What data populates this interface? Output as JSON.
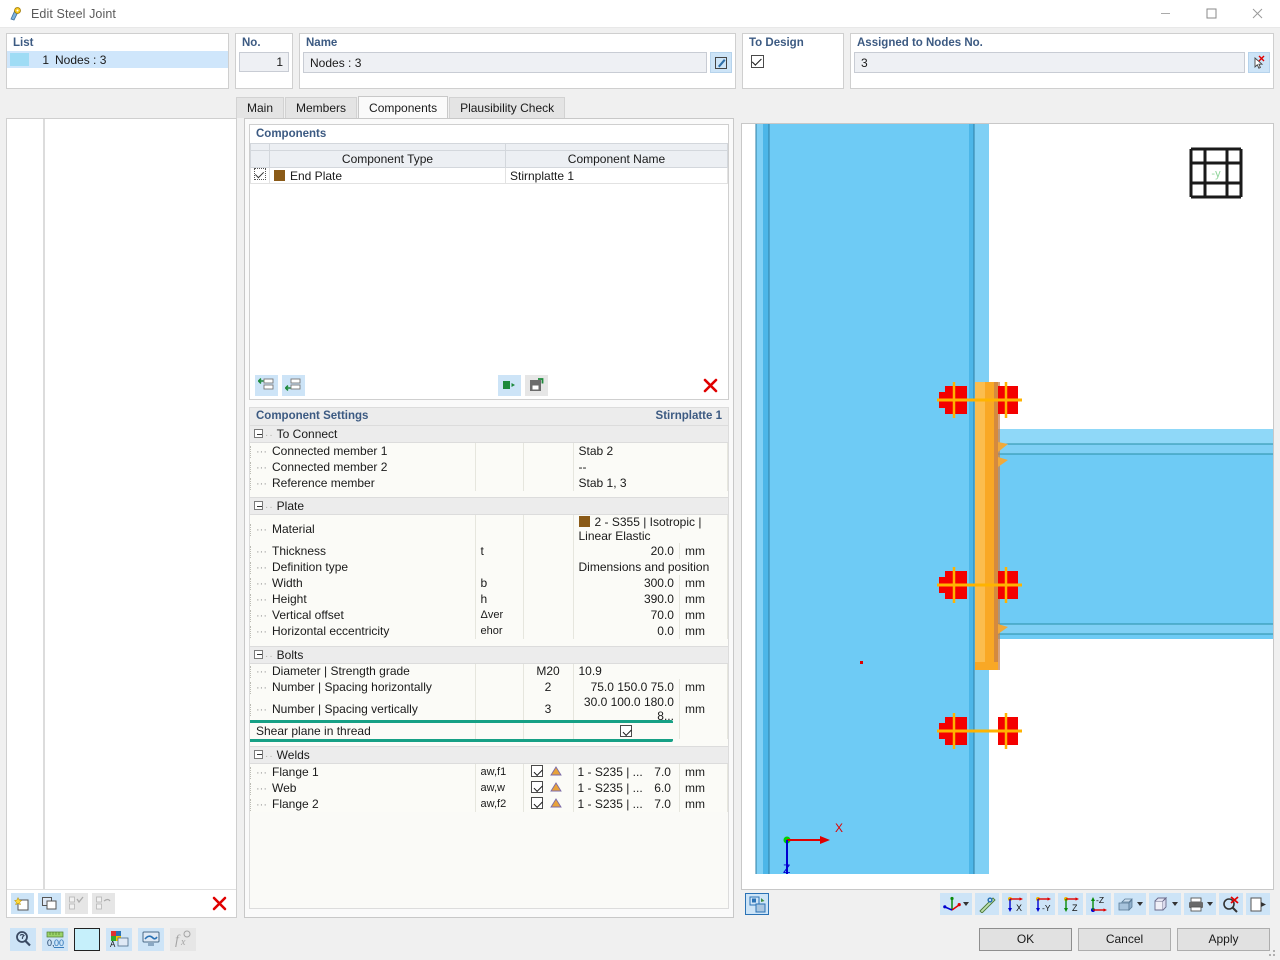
{
  "window": {
    "title": "Edit Steel Joint",
    "icon": "steel-joint-icon",
    "minimize": "—",
    "maximize": "□",
    "close": "✕"
  },
  "list_panel": {
    "label": "List",
    "rows": [
      {
        "number": "1",
        "text": "Nodes : 3"
      }
    ]
  },
  "header": {
    "no_label": "No.",
    "no_value": "1",
    "name_label": "Name",
    "name_value": "Nodes : 3",
    "name_edit_icon": "edit-pencil-icon",
    "to_design_label": "To Design",
    "to_design_checked": true,
    "assigned_label": "Assigned to Nodes No.",
    "assigned_value": "3",
    "assigned_pick_icon": "pick-node-cursor-icon"
  },
  "tabs": [
    {
      "label": "Main",
      "active": false
    },
    {
      "label": "Members",
      "active": false
    },
    {
      "label": "Components",
      "active": true
    },
    {
      "label": "Plausibility Check",
      "active": false
    }
  ],
  "components_box": {
    "title": "Components",
    "columns": [
      "Component Type",
      "Component Name"
    ],
    "rows": [
      {
        "checked": true,
        "color": "#8a5a17",
        "type": "End Plate",
        "name": "Stirnplatte 1"
      }
    ],
    "toolbar": [
      {
        "icon": "insert-row-above-icon",
        "name": "insert-component-button"
      },
      {
        "icon": "insert-row-below-icon",
        "name": "append-component-button"
      },
      {
        "icon": "import-component-icon",
        "name": "import-component-button"
      },
      {
        "icon": "save-component-icon",
        "name": "save-component-button"
      },
      {
        "icon": "delete-red-x-icon",
        "name": "delete-component-button"
      }
    ]
  },
  "component_settings": {
    "title": "Component Settings",
    "subtitle": "Stirnplatte 1",
    "groups": [
      {
        "name": "To Connect",
        "expanded": true,
        "rows": [
          {
            "label": "Connected member 1",
            "symbol": "",
            "value": "Stab 2",
            "unit": ""
          },
          {
            "label": "Connected member 2",
            "symbol": "",
            "value": "--",
            "unit": ""
          },
          {
            "label": "Reference member",
            "symbol": "",
            "value": "Stab 1, 3",
            "unit": ""
          }
        ]
      },
      {
        "name": "Plate",
        "expanded": true,
        "rows": [
          {
            "label": "Material",
            "symbol": "",
            "value": "2 - S355 | Isotropic | Linear Elastic",
            "unit": "",
            "swatch": "#8a5a17"
          },
          {
            "label": "Thickness",
            "symbol": "t",
            "value": "20.0",
            "unit": "mm",
            "numeric": true
          },
          {
            "label": "Definition type",
            "symbol": "",
            "value": "Dimensions and position",
            "unit": ""
          },
          {
            "label": "Width",
            "symbol": "b",
            "value": "300.0",
            "unit": "mm",
            "numeric": true
          },
          {
            "label": "Height",
            "symbol": "h",
            "value": "390.0",
            "unit": "mm",
            "numeric": true
          },
          {
            "label": "Vertical offset",
            "symbol": "Δver",
            "value": "70.0",
            "unit": "mm",
            "numeric": true
          },
          {
            "label": "Horizontal eccentricity",
            "symbol": "ehor",
            "value": "0.0",
            "unit": "mm",
            "numeric": true
          }
        ]
      },
      {
        "name": "Bolts",
        "expanded": true,
        "rows": [
          {
            "label": "Diameter | Strength grade",
            "symbol": "",
            "mid": "M20",
            "value": "10.9",
            "unit": ""
          },
          {
            "label": "Number | Spacing horizontally",
            "symbol": "",
            "mid": "2",
            "value": "75.0 150.0 75.0",
            "unit": "mm",
            "numeric": true
          },
          {
            "label": "Number | Spacing vertically",
            "symbol": "",
            "mid": "3",
            "value": "30.0 100.0 180.0 8...",
            "unit": "mm",
            "numeric": true
          },
          {
            "label": "Shear plane in thread",
            "symbol": "",
            "mid": "",
            "value": "",
            "unit": "",
            "checkbox": true,
            "checked": true,
            "highlighted": true
          }
        ]
      },
      {
        "name": "Welds",
        "expanded": true,
        "rows": [
          {
            "label": "Flange 1",
            "symbol": "aw,f1",
            "checked": true,
            "weld_icon": "weld-symbol-icon",
            "material": "1 - S235 | ...",
            "value": "7.0",
            "unit": "mm"
          },
          {
            "label": "Web",
            "symbol": "aw,w",
            "checked": true,
            "weld_icon": "weld-symbol-icon",
            "material": "1 - S235 | ...",
            "value": "6.0",
            "unit": "mm"
          },
          {
            "label": "Flange 2",
            "symbol": "aw,f2",
            "checked": true,
            "weld_icon": "weld-symbol-icon",
            "material": "1 - S235 | ...",
            "value": "7.0",
            "unit": "mm"
          }
        ]
      }
    ],
    "highlight_color": "#16a085"
  },
  "left_toolbar": [
    {
      "icon": "new-item-icon",
      "name": "new-joint-button",
      "enabled": true
    },
    {
      "icon": "copy-item-icon",
      "name": "copy-joint-button",
      "enabled": true
    },
    {
      "icon": "select-all-icon",
      "name": "select-all-button",
      "enabled": false
    },
    {
      "icon": "invert-selection-icon",
      "name": "invert-selection-button",
      "enabled": false
    },
    {
      "icon": "delete-red-x-icon",
      "name": "delete-joint-button",
      "enabled": true
    }
  ],
  "viewport": {
    "axis_x_label": "X",
    "axis_z_label": "Z",
    "nav_cube_label": "-y",
    "colors": {
      "member": "#6ecbf5",
      "plate": "#f9a825",
      "bolt": "#f40000",
      "background": "#ffffff",
      "axis_x": "#e00000",
      "axis_z": "#0000d0",
      "origin": "#00d000"
    },
    "toolbar": [
      {
        "icon": "render-mode-icon",
        "name": "toggle-render-mode-button",
        "framed": true
      },
      {
        "icon": "coordinate-system-icon",
        "name": "coordinate-system-button",
        "caret": true
      },
      {
        "icon": "measure-icon",
        "name": "measure-button"
      },
      {
        "icon": "view-x-icon",
        "name": "view-in-x-button"
      },
      {
        "icon": "view-minus-y-icon",
        "name": "view-against-y-button"
      },
      {
        "icon": "view-z-icon",
        "name": "view-in-z-button"
      },
      {
        "icon": "view-minus-z-icon",
        "name": "view-against-z-button"
      },
      {
        "icon": "shading-icon",
        "name": "display-mode-button",
        "caret": true
      },
      {
        "icon": "wireframe-cube-icon",
        "name": "view-style-button",
        "caret": true
      },
      {
        "icon": "print-icon",
        "name": "print-button",
        "caret": true
      },
      {
        "icon": "zoom-reset-icon",
        "name": "reset-zoom-button"
      },
      {
        "icon": "panel-toggle-icon",
        "name": "toggle-panel-button"
      }
    ]
  },
  "status_toolbar": [
    {
      "icon": "magnifier-icon",
      "name": "find-button",
      "enabled": true
    },
    {
      "icon": "decimal-places-icon",
      "name": "decimal-places-button",
      "enabled": true
    },
    {
      "icon": "color-swatch-icon",
      "name": "color-button",
      "enabled": true
    },
    {
      "icon": "display-properties-icon",
      "name": "display-properties-button",
      "enabled": true
    },
    {
      "icon": "visibility-icon",
      "name": "visibility-button",
      "enabled": true
    },
    {
      "icon": "formula-icon",
      "name": "formula-button",
      "enabled": false
    }
  ],
  "footer": {
    "ok": "OK",
    "cancel": "Cancel",
    "apply": "Apply"
  }
}
